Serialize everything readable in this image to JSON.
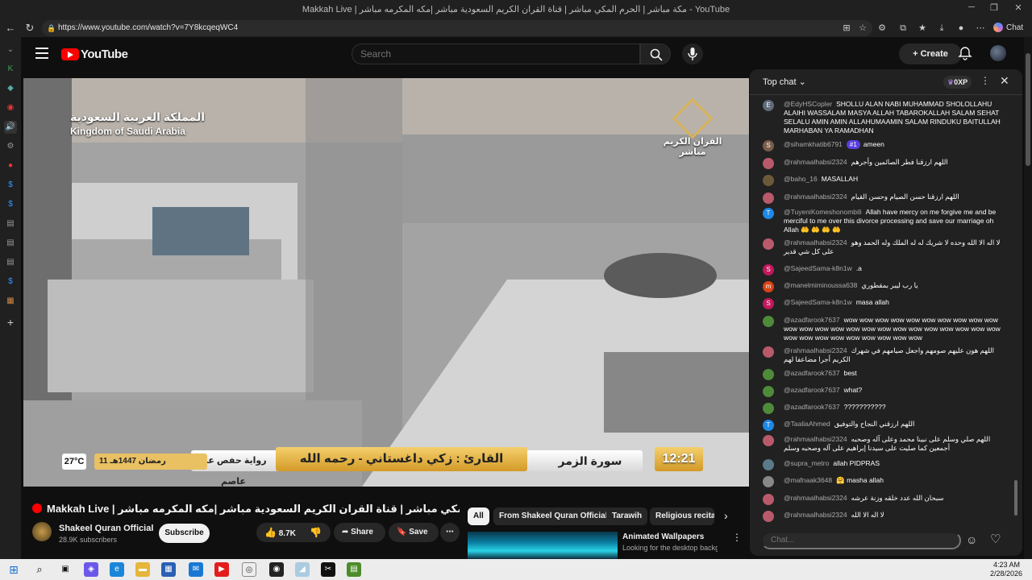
{
  "browser": {
    "title": "Makkah Live | مكة مباشر | الحرم المكي مباشر | قناة القران الكريم السعودية مباشر |مكه المكرمه مباشر - YouTube",
    "url": "https://www.youtube.com/watch?v=7Y8kcqeqWC4",
    "chat_label": "Chat"
  },
  "youtube": {
    "logo": "YouTube",
    "search_placeholder": "Search",
    "create_label": "Create"
  },
  "video_overlay": {
    "arabic_top_left": "المملكة العربية السعودية",
    "english_top_left": "Kingdom of Saudi Arabia",
    "channel_logo_text": "القران الكريم مباشر",
    "reader": "القارئ : زكي داغستاني - رحمه الله",
    "surah": "سورة الزمر",
    "riwaya": "رواية حفص عن عاصم",
    "hijri_date": "11 رمضان 1447هـ",
    "temperature": "27°C",
    "clock": "12:21"
  },
  "video": {
    "title": "Makkah Live | مكة مباشر | الحرم المكي مباشر | قناة القران الكريم السعودية مباشر |مكه المكرمه مباشر",
    "channel": "Shakeel Quran Official",
    "subscribers": "28.9K subscribers",
    "subscribe_label": "Subscribe",
    "likes": "8.7K",
    "share_label": "Share",
    "save_label": "Save"
  },
  "chips": [
    "All",
    "From Shakeel Quran Official",
    "Tarawih",
    "Religious recitat"
  ],
  "recommendation": {
    "title": "Animated Wallpapers",
    "desc": "Looking for the desktop backgrounds? Explore a curated"
  },
  "chat": {
    "mode": "Top chat",
    "xp": "0XP",
    "input_placeholder": "Chat...",
    "messages": [
      {
        "author": "@EdyHSCopler",
        "text": "SHOLLU ALAN NABI MUHAMMAD SHOLOLLAHU ALAIHI WASSALAM MASYA ALLAH TABAROKALLAH SALAM SEHAT SELALU AMIN AMIN ALLAHUMAAMIN SALAM RINDUKU BAITULLAH MARHABAN YA RAMADHAN",
        "initial": "E",
        "color": "#5f6b7a"
      },
      {
        "author": "@sihamkhatib6791",
        "badge": "#1",
        "text": "ameen",
        "initial": "S",
        "color": "#7a5c4b"
      },
      {
        "author": "@rahmaalhabsi2324",
        "text": "اللهم ارزقنا فطر الصائمين وأجرهم",
        "initial": "",
        "color": "#b85a6a"
      },
      {
        "author": "@baho_16",
        "text": "MASALLAH",
        "initial": "",
        "color": "#6b5a3a"
      },
      {
        "author": "@rahmaalhabsi2324",
        "text": "اللهم ارزقنا حسن الصيام وحسن القيام",
        "initial": "",
        "color": "#b85a6a"
      },
      {
        "author": "@TuyeniKomeshonombili",
        "text": "Allah have mercy on me forgive me and be merciful to me over this divorce processing and save our marriage oh Allah 🤲 🤲 🤲 🤲",
        "initial": "T",
        "color": "#1e88e5"
      },
      {
        "author": "@rahmaalhabsi2324",
        "text": "لا اله الا الله وحده لا شريك له له الملك وله الحمد وهو على كل شي قدير",
        "initial": "",
        "color": "#b85a6a"
      },
      {
        "author": "@SajeedSama-k8n1w",
        "text": ".a",
        "initial": "S",
        "color": "#c2185b"
      },
      {
        "author": "@manelmiminoussa638",
        "text": "يا رب ليبر بمقطوري",
        "initial": "m",
        "color": "#d84315"
      },
      {
        "author": "@SajeedSama-k8n1w",
        "text": "masa allah",
        "initial": "S",
        "color": "#c2185b"
      },
      {
        "author": "@azadfarook7637",
        "text": "wow wow wow wow wow wow wow wow wow wow wow wow wow wow wow wow wow wow wow wow wow wow wow wow wow wow wow wow wow wow wow wow wow",
        "initial": "",
        "color": "#4f8a3a"
      },
      {
        "author": "@rahmaalhabsi2324",
        "text": "اللهم هون عليهم صومهم واجعل صيامهم في شهرك الكريم أجرا مضاعفا لهم",
        "initial": "",
        "color": "#b85a6a"
      },
      {
        "author": "@azadfarook7637",
        "text": "best",
        "initial": "",
        "color": "#4f8a3a"
      },
      {
        "author": "@azadfarook7637",
        "text": "what?",
        "initial": "",
        "color": "#4f8a3a"
      },
      {
        "author": "@azadfarook7637",
        "text": "???????????",
        "initial": "",
        "color": "#4f8a3a"
      },
      {
        "author": "@TaaliaAhmed",
        "text": "اللهم ارزقني النجاح والتوفيق",
        "initial": "T",
        "color": "#1e88e5"
      },
      {
        "author": "@rahmaalhabsi2324",
        "text": "اللهم صلي وسلم على نبينا محمد وعلى آله وصحبه أجمعين كما صليت على سيدنا إبراهيم على آله وصحبه وسلم",
        "initial": "",
        "color": "#b85a6a"
      },
      {
        "author": "@supra_metro",
        "text": "allah PIDPRAS",
        "initial": "",
        "color": "#5a7a8a"
      },
      {
        "author": "@mafnaak3648",
        "text": "🤗 masha allah",
        "initial": "",
        "color": "#888"
      },
      {
        "author": "@rahmaalhabsi2324",
        "text": "سبحان الله عدد خلقه وزنة عرشه",
        "initial": "",
        "color": "#b85a6a"
      },
      {
        "author": "@rahmaalhabsi2324",
        "text": "لا اله الا الله",
        "initial": "",
        "color": "#b85a6a"
      }
    ]
  },
  "taskbar": {
    "time": "4:23 AM",
    "date": "2/28/2026"
  }
}
